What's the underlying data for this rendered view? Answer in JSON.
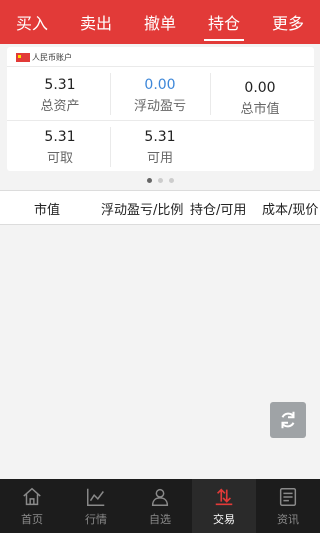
{
  "top_tabs": [
    {
      "label": "买入"
    },
    {
      "label": "卖出"
    },
    {
      "label": "撤单"
    },
    {
      "label": "持仓"
    },
    {
      "label": "更多"
    }
  ],
  "account": {
    "label": "人民币账户"
  },
  "summary": {
    "total_assets": {
      "value": "5.31",
      "label": "总资产"
    },
    "floating_pl": {
      "value": "0.00",
      "label": "浮动盈亏"
    },
    "market_value": {
      "value": "0.00",
      "label": "总市值"
    },
    "withdrawable": {
      "value": "5.31",
      "label": "可取"
    },
    "available": {
      "value": "5.31",
      "label": "可用"
    }
  },
  "pager": {
    "count": 3,
    "active": 0
  },
  "table": {
    "headers": [
      "市值",
      "浮动盈亏/比例",
      "持仓/可用",
      "成本/现价"
    ]
  },
  "bottom_nav": [
    {
      "label": "首页",
      "icon": "home-icon"
    },
    {
      "label": "行情",
      "icon": "chart-icon"
    },
    {
      "label": "自选",
      "icon": "person-icon"
    },
    {
      "label": "交易",
      "icon": "trade-icon"
    },
    {
      "label": "资讯",
      "icon": "news-icon"
    }
  ],
  "colors": {
    "accent": "#e23a38",
    "blue": "#3d87d9",
    "nav_bg": "#1c1c1c"
  }
}
